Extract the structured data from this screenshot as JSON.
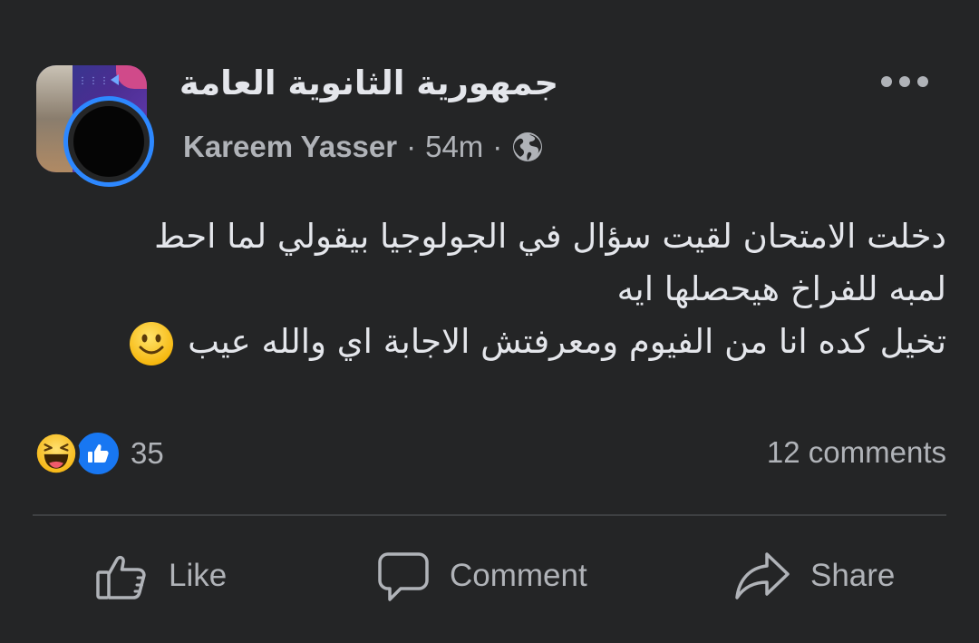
{
  "post": {
    "group_name": "جمهورية الثانوية العامة",
    "author": "Kareem Yasser",
    "separator": "·",
    "time": "54m",
    "privacy_icon": "globe-icon",
    "more_icon": "more-options-icon",
    "text_lines": [
      "دخلت الامتحان لقيت سؤال في الجولوجيا بيقولي لما احط",
      "لمبه للفراخ هيحصلها ايه",
      "تخيل كده انا من الفيوم ومعرفتش الاجابة اي والله عيب"
    ],
    "inline_emoji": "slightly-smiling-face"
  },
  "engagement": {
    "reaction_icons": [
      "haha-reaction-icon",
      "like-reaction-icon"
    ],
    "reaction_count": "35",
    "comments": "12 comments"
  },
  "actions": {
    "like_label": "Like",
    "comment_label": "Comment",
    "share_label": "Share"
  },
  "colors": {
    "background": "#242526",
    "primary_text": "#e4e6eb",
    "secondary_text": "#b0b3b8",
    "accent_blue": "#2d88ff",
    "divider": "#3e4042"
  }
}
